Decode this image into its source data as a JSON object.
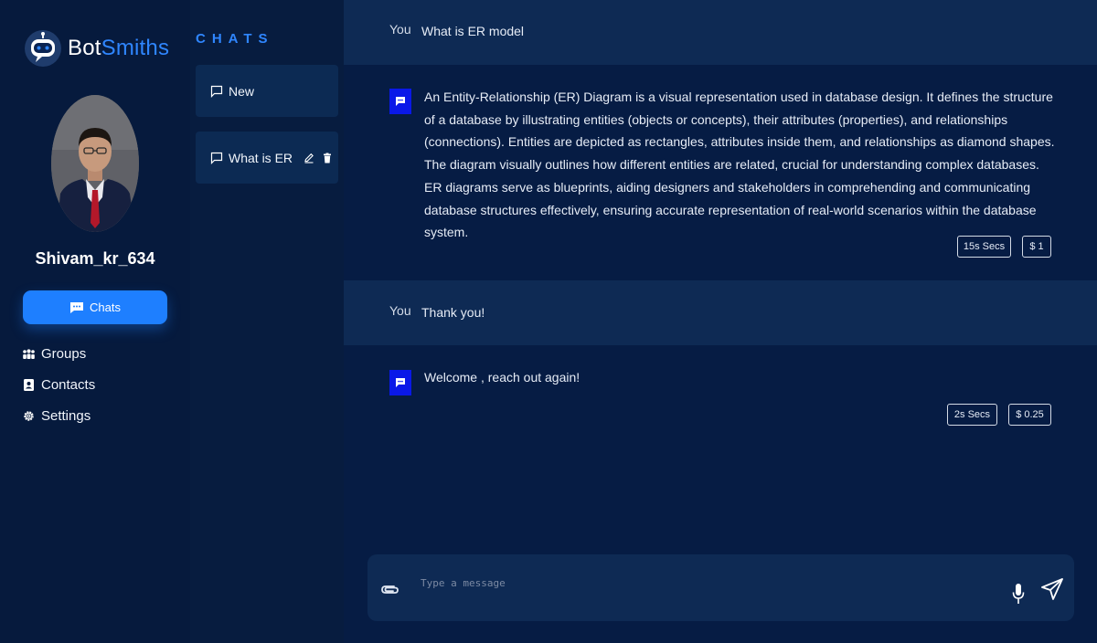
{
  "brand": {
    "part1": "Bot",
    "part2": "Smiths",
    "logo_icon": "robot-icon"
  },
  "profile": {
    "username": "Shivam_kr_634"
  },
  "nav": {
    "chats_label": "Chats",
    "groups_label": "Groups",
    "contacts_label": "Contacts",
    "settings_label": "Settings"
  },
  "chatlist": {
    "title": "CHATS",
    "items": [
      {
        "label": "New"
      },
      {
        "label": "What is ER model"
      }
    ]
  },
  "conversation": [
    {
      "user_label": "You",
      "user_message": "What is ER model",
      "bot_reply": "An Entity-Relationship (ER) Diagram is a visual representation used in database design. It defines the structure of a database by illustrating entities (objects or concepts), their attributes (properties), and relationships (connections). Entities are depicted as rectangles, attributes inside them, and relationships as diamond shapes. The diagram visually outlines how different entities are related, crucial for understanding complex databases. ER diagrams serve as blueprints, aiding designers and stakeholders in comprehending and communicating database structures effectively, ensuring accurate representation of real-world scenarios within the database system.",
      "time": "15s Secs",
      "cost": "$ 1"
    },
    {
      "user_label": "You",
      "user_message": "Thank you!",
      "bot_reply": "Welcome , reach out again!",
      "time": "2s Secs",
      "cost": "$ 0.25"
    }
  ],
  "composer": {
    "placeholder": "Type a message"
  },
  "colors": {
    "accent": "#1e7fff",
    "brand_blue": "#2f86ff",
    "bot_icon": "#0a18e8",
    "background": "#061c44"
  }
}
